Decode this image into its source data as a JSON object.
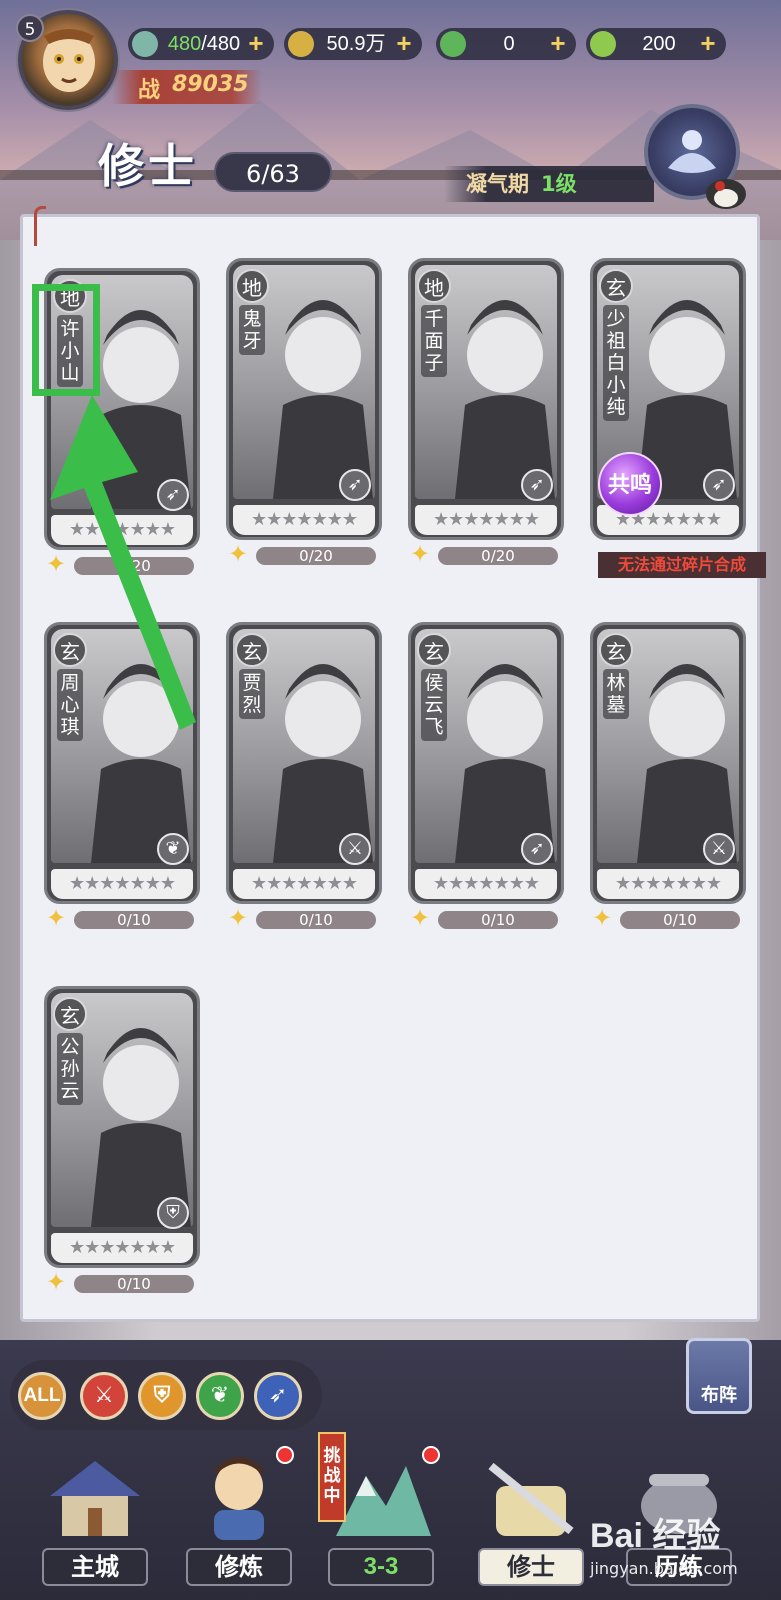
{
  "player": {
    "level": "5",
    "power_label": "战",
    "power": "89035"
  },
  "resources": [
    {
      "icon": "stamina-icon",
      "value_current": "480",
      "value_max": "/480"
    },
    {
      "icon": "coin-icon",
      "value": "50.9万"
    },
    {
      "icon": "spirit-stone-icon",
      "value": "0"
    },
    {
      "icon": "leaf-icon",
      "value": "200"
    }
  ],
  "page": {
    "title": "修士",
    "count": "6/63",
    "realm": "凝气期",
    "realm_level": "1级"
  },
  "cards": [
    {
      "grade": "地",
      "name": "许小山",
      "role": "bow-icon",
      "fragments": "0/20"
    },
    {
      "grade": "地",
      "name": "鬼牙",
      "role": "bow-icon",
      "fragments": "0/20"
    },
    {
      "grade": "地",
      "name": "千面子",
      "role": "bow-icon",
      "fragments": "0/20"
    },
    {
      "grade": "玄",
      "name": "少祖白小纯",
      "role": "bow-icon",
      "fragments": "",
      "badge": "共鸣",
      "note": "无法通过碎片合成"
    },
    {
      "grade": "玄",
      "name": "周心琪",
      "role": "leaf-icon",
      "fragments": "0/10"
    },
    {
      "grade": "玄",
      "name": "贾烈",
      "role": "sword-icon",
      "fragments": "0/10"
    },
    {
      "grade": "玄",
      "name": "侯云飞",
      "role": "bow-icon",
      "fragments": "0/10"
    },
    {
      "grade": "玄",
      "name": "林墓",
      "role": "sword-icon",
      "fragments": "0/10"
    },
    {
      "grade": "玄",
      "name": "公孙云",
      "role": "shield-icon",
      "fragments": "0/10"
    }
  ],
  "stars": "★★★★★★★",
  "filters": [
    {
      "label": "ALL",
      "color": "#d8933a"
    },
    {
      "icon": "sword-icon",
      "color": "#d2443a"
    },
    {
      "icon": "shield-icon",
      "color": "#e0962c"
    },
    {
      "icon": "leaf-icon",
      "color": "#3fa34a"
    },
    {
      "icon": "bow-icon",
      "color": "#3d62b8"
    }
  ],
  "formation_label": "布阵",
  "nav": [
    {
      "label": "主城"
    },
    {
      "label": "修炼"
    },
    {
      "label": "3-3",
      "badge": "挑战中"
    },
    {
      "label": "修士"
    },
    {
      "label": "历练"
    }
  ],
  "watermark": {
    "line1": "Bai 经验",
    "line2": "jingyan.baidu.com"
  },
  "colors": {
    "accent_green": "#3bbd49",
    "resource_green": "#7de066",
    "warning_red": "#f04b3a"
  }
}
